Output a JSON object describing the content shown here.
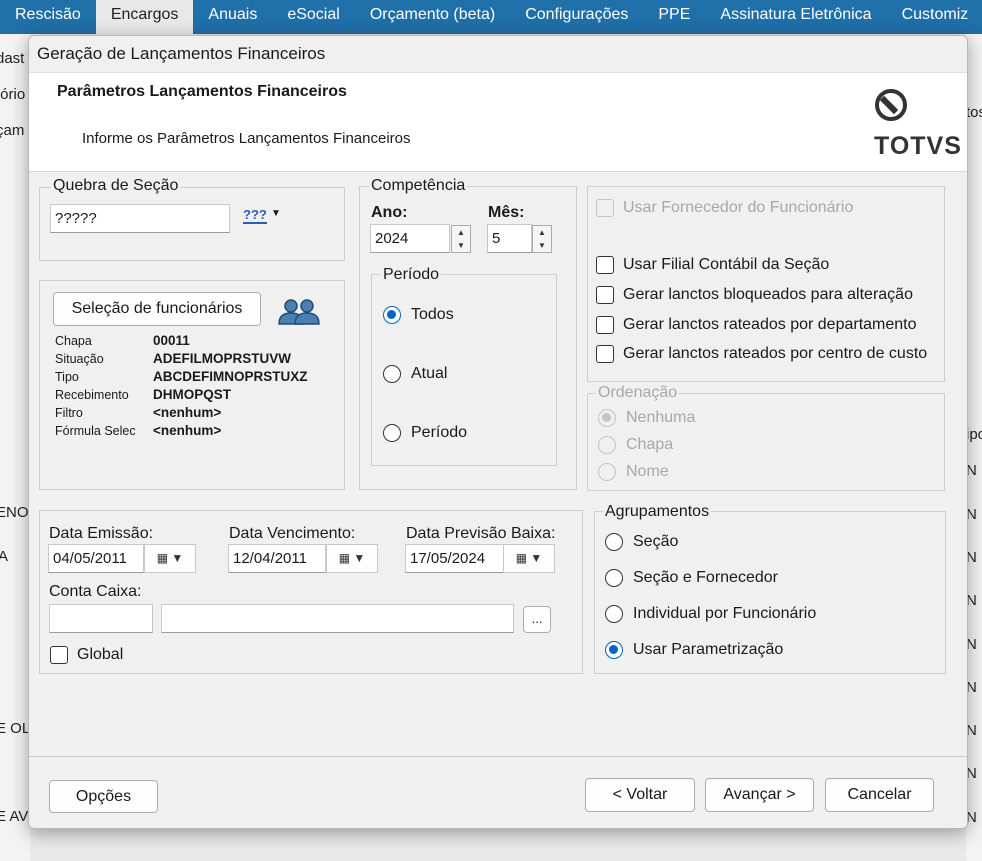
{
  "top_menu": [
    "Rescisão",
    "Encargos",
    "Anuais",
    "eSocial",
    "Orçamento (beta)",
    "Configurações",
    "PPE",
    "Assinatura Eletrônica",
    "Customiz"
  ],
  "background": {
    "left_fragments": [
      "dast",
      "tório",
      "çam"
    ],
    "left_rows": [
      "ENO",
      "A",
      "E OLI",
      "E AV"
    ],
    "right_fragments": [
      "tos",
      "ipo"
    ],
    "right_col": [
      "N",
      "N",
      "N",
      "N",
      "N",
      "N",
      "N",
      "N",
      "N",
      "N"
    ]
  },
  "dialog": {
    "title": "Geração de Lançamentos Financeiros",
    "header_title": "Parâmetros Lançamentos Financeiros",
    "header_subtitle": "Informe os Parâmetros Lançamentos Financeiros",
    "logo_text": "TOTVS"
  },
  "quebra": {
    "legend": "Quebra de Seção",
    "value": "?????",
    "lookup_icon": "???"
  },
  "selecao": {
    "button": "Seleção de funcionários",
    "rows": [
      {
        "key": "Chapa",
        "value": "00011"
      },
      {
        "key": "Situação",
        "value": "ADEFILMOPRSTUVW"
      },
      {
        "key": "Tipo",
        "value": "ABCDEFIMNOPRSTUXZ"
      },
      {
        "key": "Recebimento",
        "value": "DHMOPQST"
      },
      {
        "key": "Filtro",
        "value": "<nenhum>"
      },
      {
        "key": "Fórmula Selec",
        "value": "<nenhum>"
      }
    ]
  },
  "competencia": {
    "legend": "Competência",
    "ano_label": "Ano:",
    "ano_value": "2024",
    "mes_label": "Mês:",
    "mes_value": "5",
    "periodo_legend": "Período",
    "options": [
      "Todos",
      "Atual",
      "Período"
    ],
    "selected": "Todos"
  },
  "checkboxes": {
    "usar_fornecedor": "Usar Fornecedor do Funcionário",
    "items": [
      "Usar Filial Contábil da Seção",
      "Gerar lanctos bloqueados para alteração",
      "Gerar lanctos rateados por departamento",
      "Gerar lanctos rateados por centro de custo"
    ]
  },
  "ordenacao": {
    "legend": "Ordenação",
    "options": [
      "Nenhuma",
      "Chapa",
      "Nome"
    ],
    "selected": "Nenhuma"
  },
  "datas": {
    "emissao_label": "Data Emissão:",
    "emissao_value": "04/05/2011",
    "vencimento_label": "Data Vencimento:",
    "vencimento_value": "12/04/2011",
    "previsao_label": "Data Previsão Baixa:",
    "previsao_value": "17/05/2024",
    "conta_caixa_label": "Conta Caixa:",
    "ellipsis": "...",
    "global_label": "Global"
  },
  "agrupamentos": {
    "legend": "Agrupamentos",
    "options": [
      "Seção",
      "Seção e Fornecedor",
      "Individual por Funcionário",
      "Usar Parametrização"
    ],
    "selected": "Usar Parametrização"
  },
  "buttons": {
    "opcoes": "Opções",
    "voltar": "< Voltar",
    "avancar": "Avançar >",
    "cancelar": "Cancelar"
  },
  "colors": {
    "menu_bg": "#1f6fa8",
    "accent": "#0067c0"
  }
}
